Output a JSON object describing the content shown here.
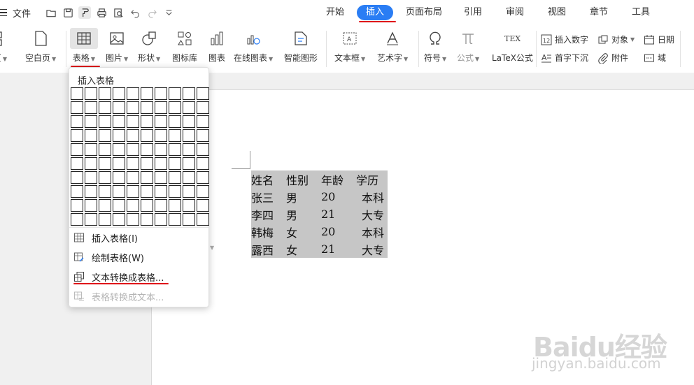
{
  "menubar": {
    "file_label": "文件",
    "quick_access_icons": [
      "open-folder-icon",
      "save-icon",
      "format-painter-icon",
      "print-icon",
      "print-preview-icon",
      "undo-icon",
      "redo-icon",
      "customize-chevron-icon"
    ],
    "tabs": [
      "开始",
      "插入",
      "页面布局",
      "引用",
      "审阅",
      "视图",
      "章节",
      "工具"
    ],
    "active_tab": "插入"
  },
  "ribbon": {
    "page_partial": "页",
    "blank_page": "空白页",
    "table": "表格",
    "picture": "图片",
    "shape": "形状",
    "icon_lib": "图标库",
    "chart": "图表",
    "online_chart": "在线图表",
    "smart_shape": "智能图形",
    "textbox": "文本框",
    "art_text": "艺术字",
    "symbol": "符号",
    "formula": "公式",
    "latex": "LaTeX公式",
    "insert_number": "插入数字",
    "object": "对象",
    "date": "日期",
    "drop_cap": "首字下沉",
    "attachment": "附件",
    "field": "域"
  },
  "dropdown": {
    "title": "插入表格",
    "grid_rows": 10,
    "grid_cols": 10,
    "items": [
      {
        "label": "插入表格(I)",
        "disabled": false
      },
      {
        "label": "绘制表格(W)",
        "disabled": false
      },
      {
        "label": "文本转换成表格...",
        "disabled": false
      },
      {
        "label": "表格转换成文本...",
        "disabled": true
      }
    ]
  },
  "document": {
    "table": [
      [
        "姓名",
        "性别",
        "年龄",
        "学历"
      ],
      [
        "张三",
        "男",
        "20",
        "本科"
      ],
      [
        "李四",
        "男",
        "21",
        "大专"
      ],
      [
        "韩梅",
        "女",
        "20",
        "本科"
      ],
      [
        "露西",
        "女",
        "21",
        "大专"
      ]
    ]
  },
  "watermark": {
    "brand": "Baidu经验",
    "url": "jingyan.baidu.com"
  },
  "colors": {
    "accent": "#2a7df4",
    "annotation_red": "#e0141a",
    "selection_gray": "#c6c6c6"
  }
}
